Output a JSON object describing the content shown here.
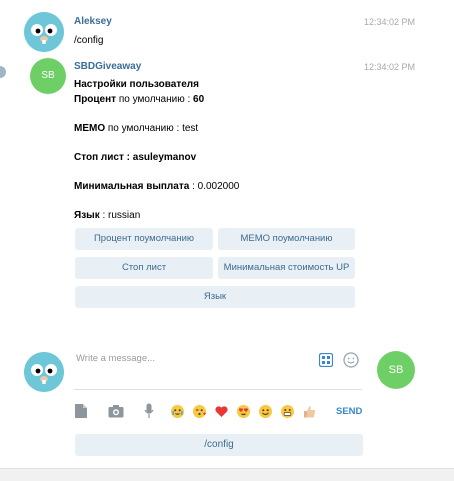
{
  "messages": [
    {
      "sender": "Aleksey",
      "time": "12:34:02 PM",
      "text": "/config"
    },
    {
      "sender": "SBDGiveaway",
      "avatar_text": "SB",
      "time": "12:34:02 PM",
      "lines": {
        "title": "Настройки пользователя",
        "percent_label": "Процент",
        "percent_rest": " по умолчанию : ",
        "percent_value": "60",
        "memo_label": "МЕМО",
        "memo_rest": " по умолчанию : test",
        "stoplist_label": "Стоп лист : ",
        "stoplist_value": "asuleymanov",
        "minpay_label": "Минимальная выплата",
        "minpay_rest": " : 0.002000",
        "lang_label": "Язык",
        "lang_rest": " : russian"
      }
    }
  ],
  "keyboard": {
    "btn_percent": "Процент поумолчанию",
    "btn_memo": "MEMO поумолчанию",
    "btn_stoplist": "Стоп лист",
    "btn_mincost": "Минимальная стоимость UP",
    "btn_lang": "Язык"
  },
  "composer": {
    "placeholder": "Write a message...",
    "send_label": "SEND",
    "user_avatar_text": "SB",
    "command_button": "/config"
  },
  "colors": {
    "accent": "#3a88c7",
    "button_bg": "#e9f0f5",
    "sb_avatar": "#6fcf67"
  }
}
